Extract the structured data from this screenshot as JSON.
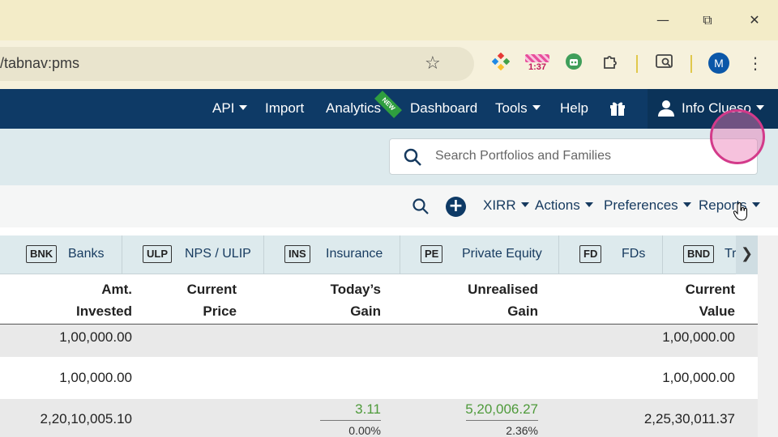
{
  "browser": {
    "url_fragment": "/tabnav:pms",
    "extension_badge": "1:37",
    "profile_initial": "M",
    "window": {
      "minimize": "—",
      "restore": "⧉",
      "close": "✕"
    }
  },
  "nav": {
    "items": [
      {
        "label": "API",
        "dropdown": true
      },
      {
        "label": "Import",
        "dropdown": false
      },
      {
        "label": "Analytics",
        "dropdown": false,
        "badge": "NEW"
      },
      {
        "label": "Dashboard",
        "dropdown": false
      },
      {
        "label": "Tools",
        "dropdown": true
      },
      {
        "label": "Help",
        "dropdown": false
      }
    ],
    "user": "Info Clueso"
  },
  "search": {
    "placeholder": "Search Portfolios and Families"
  },
  "toolbar": {
    "xirr": "XIRR",
    "actions": "Actions",
    "preferences": "Preferences",
    "reports": "Reports"
  },
  "tabs": [
    {
      "code": "BNK",
      "label": "Banks"
    },
    {
      "code": "ULP",
      "label": "NPS / ULIP"
    },
    {
      "code": "INS",
      "label": "Insurance"
    },
    {
      "code": "PE",
      "label": "Private Equity"
    },
    {
      "code": "FD",
      "label": "FDs"
    },
    {
      "code": "BND",
      "label": "Tra"
    }
  ],
  "table": {
    "columns": [
      {
        "line1": "Amt.",
        "line2": "Invested"
      },
      {
        "line1": "Current",
        "line2": "Price"
      },
      {
        "line1": "Today’s",
        "line2": "Gain"
      },
      {
        "line1": "Unrealised",
        "line2": "Gain"
      },
      {
        "line1": "Current",
        "line2": "Value"
      }
    ],
    "rows": [
      {
        "invested": "1,00,000.00",
        "value": "1,00,000.00"
      },
      {
        "invested": "1,00,000.00",
        "value": "1,00,000.00"
      },
      {
        "invested": "2,20,10,005.10",
        "today_gain": "3.11",
        "today_pct": "0.00%",
        "unrealised": "5,20,006.27",
        "unrealised_pct": "2.36%",
        "value": "2,25,30,011.37"
      }
    ]
  },
  "colors": {
    "navbar": "#0e3a66",
    "accent_green": "#4e9a3a",
    "band": "#ddeaed",
    "titlebar": "#f3ecc8"
  }
}
